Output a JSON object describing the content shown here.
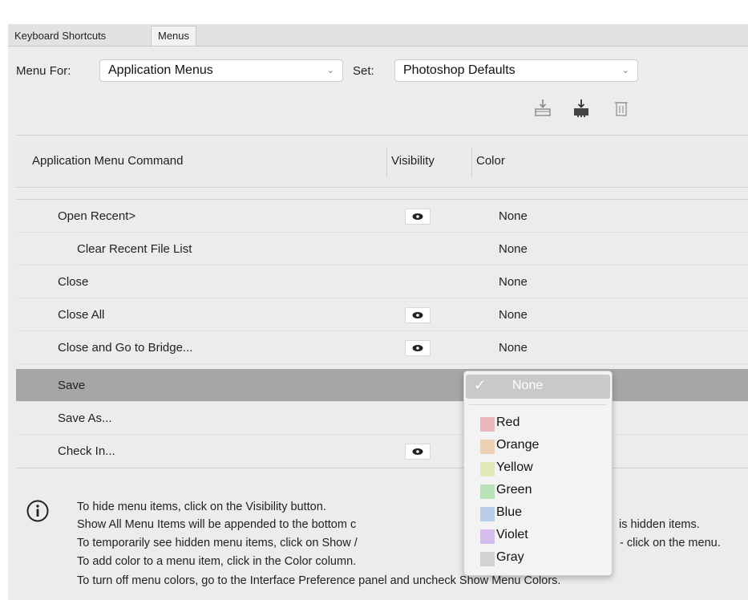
{
  "tabs": [
    {
      "label": "Keyboard Shortcuts"
    },
    {
      "label": "Menus"
    }
  ],
  "controls": {
    "menu_for_label": "Menu For:",
    "menu_for_value": "Application Menus",
    "set_label": "Set:",
    "set_value": "Photoshop Defaults"
  },
  "toolbar_icons": [
    "save-set-icon",
    "save-set-as-icon",
    "delete-set-icon"
  ],
  "table": {
    "headers": [
      "Application Menu Command",
      "Visibility",
      "Color"
    ],
    "rows": [
      {
        "name": "Open Recent>",
        "visible": true,
        "color": "None",
        "indent": 1
      },
      {
        "name": "Clear Recent File List",
        "visible": false,
        "color": "None",
        "indent": 2
      },
      {
        "name": "Close",
        "visible": false,
        "color": "None",
        "indent": 1
      },
      {
        "name": "Close All",
        "visible": true,
        "color": "None",
        "indent": 1
      },
      {
        "name": "Close and Go to Bridge...",
        "visible": true,
        "color": "None",
        "indent": 1
      },
      {
        "name": "Save",
        "visible": false,
        "color": "",
        "indent": 1,
        "selected": true
      },
      {
        "name": "Save As...",
        "visible": false,
        "color": "",
        "indent": 1
      },
      {
        "name": "Check In...",
        "visible": true,
        "color": "",
        "indent": 1
      }
    ]
  },
  "color_dropdown": {
    "selected": "None",
    "options": [
      {
        "label": "Red",
        "swatch": "#e8b7b9"
      },
      {
        "label": "Orange",
        "swatch": "#ecd0b3"
      },
      {
        "label": "Yellow",
        "swatch": "#e4e8b8"
      },
      {
        "label": "Green",
        "swatch": "#b8e2b8"
      },
      {
        "label": "Blue",
        "swatch": "#b8cde8"
      },
      {
        "label": "Violet",
        "swatch": "#d4bcec"
      },
      {
        "label": "Gray",
        "swatch": "#d2d2d2"
      }
    ]
  },
  "info": {
    "lines": [
      "To hide menu items, click on the Visibility button.",
      "Show All Menu Items will be appended to the bottom c",
      "To temporarily see hidden menu items, click on Show /",
      "To add color to a menu item, click in the Color column.",
      "To turn off menu colors, go to the Interface Preference panel and uncheck Show Menu Colors."
    ],
    "fragments": [
      "is hidden items.",
      "- click on the menu."
    ]
  }
}
